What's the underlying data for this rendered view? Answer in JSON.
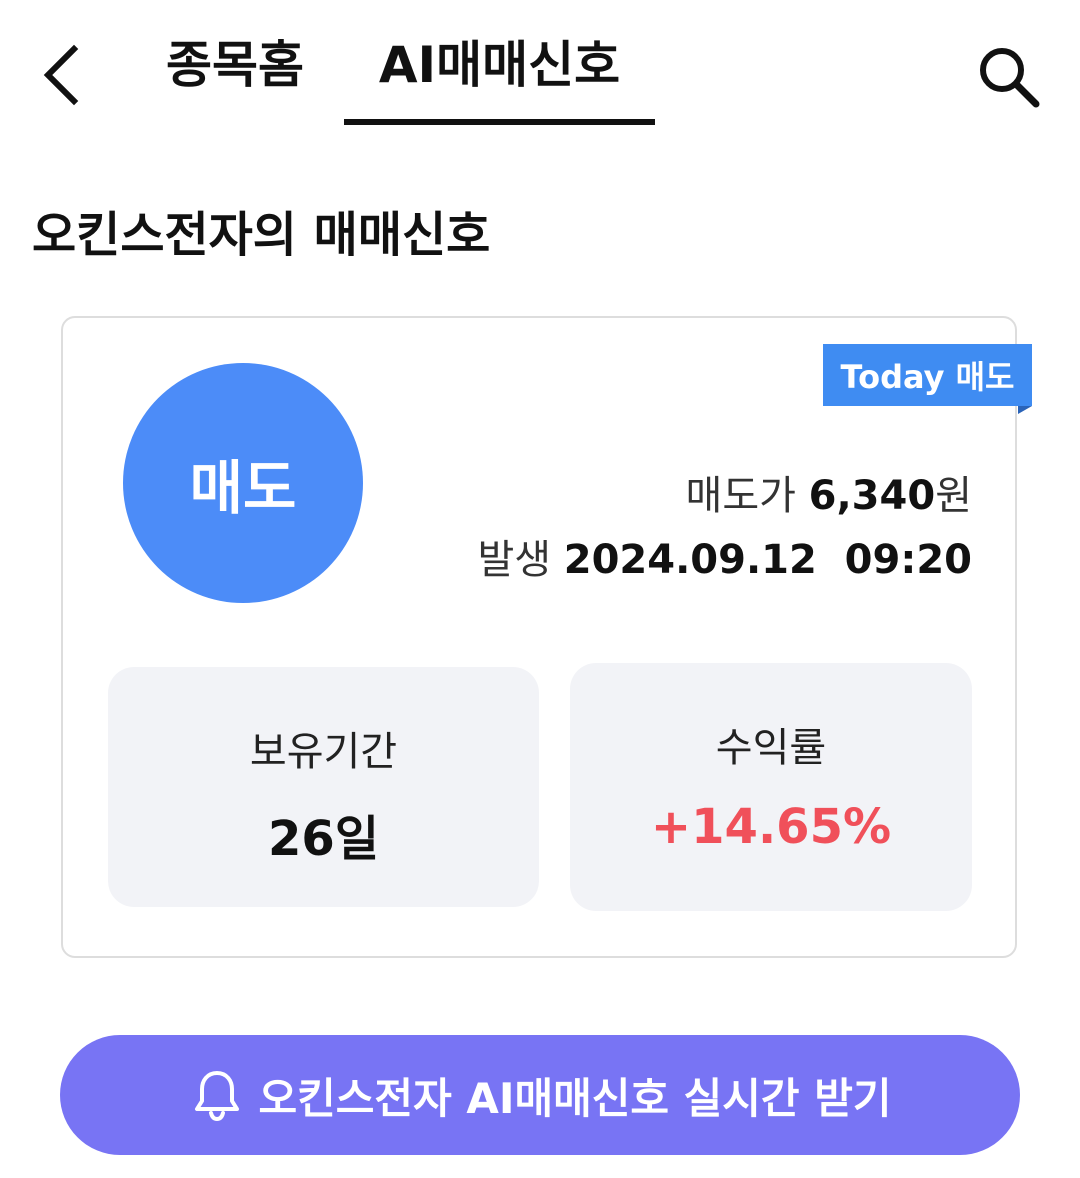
{
  "header": {
    "back_icon": "chevron-left-icon",
    "tabs": [
      {
        "label": "종목홈",
        "active": false
      },
      {
        "label": "AI매매신호",
        "active": true
      }
    ],
    "search_icon": "search-icon"
  },
  "section": {
    "title": "오킨스전자의 매매신호"
  },
  "signal_card": {
    "badge": "Today 매도",
    "signal_label": "매도",
    "price_label": "매도가",
    "price_value": "6,340",
    "price_unit": "원",
    "date_label": "발생",
    "date_value": "2024.09.12  09:20",
    "holding_period_label": "보유기간",
    "holding_period_value": "26일",
    "return_label": "수익률",
    "return_value": "+14.65%"
  },
  "cta": {
    "icon": "bell-icon",
    "label": "오킨스전자 AI매매신호 실시간 받기"
  },
  "colors": {
    "accent_blue": "#4c8cf8",
    "badge_blue": "#3f8cf2",
    "return_red": "#f0505a",
    "cta_purple": "#7874f4",
    "box_bg": "#f2f3f7"
  }
}
